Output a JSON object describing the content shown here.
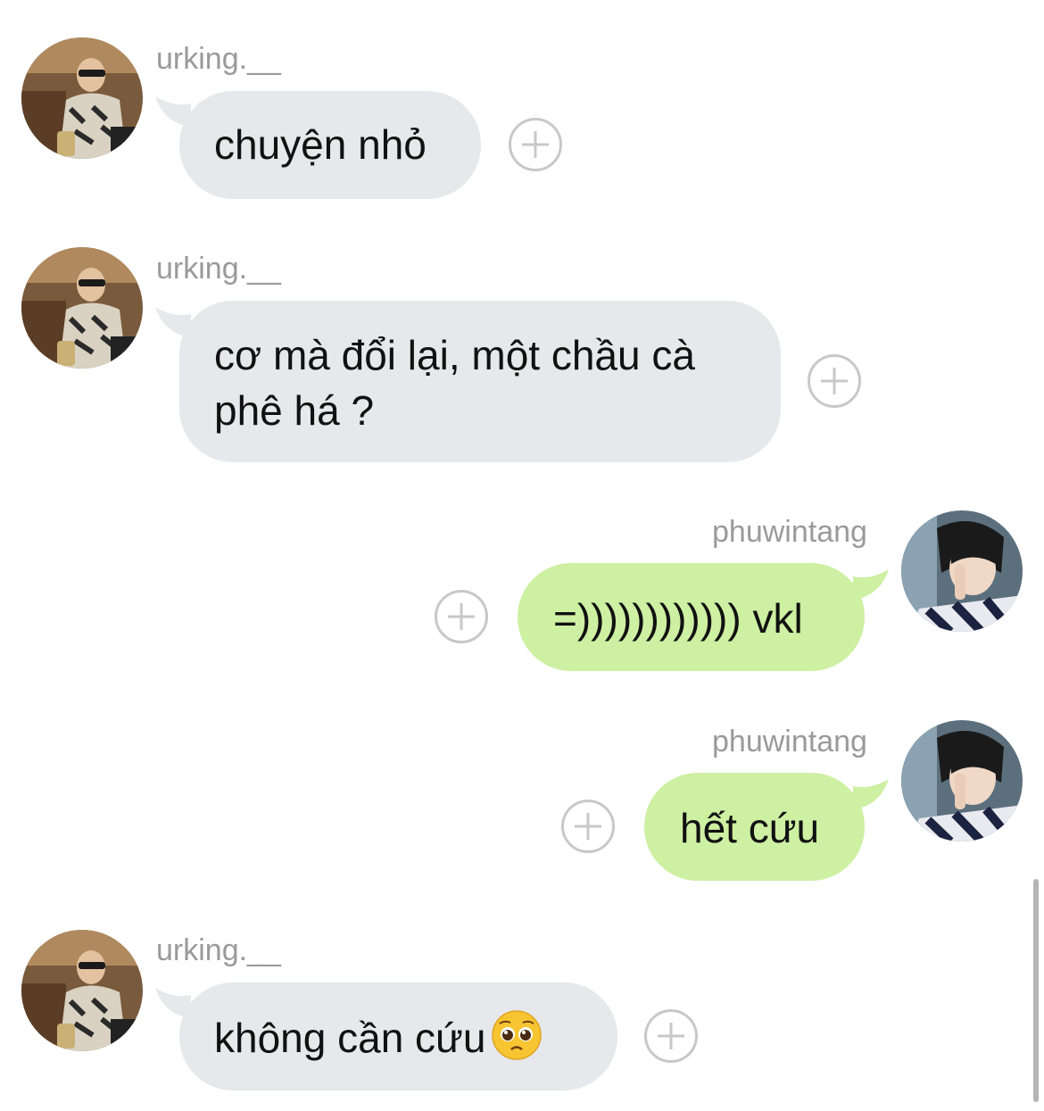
{
  "conversation": {
    "messages": [
      {
        "sender": "urking.__",
        "text": "chuyện nhỏ"
      },
      {
        "sender": "urking.__",
        "text_line1": "cơ mà đổi lại, một chầu cà",
        "text_line2": "phê há ?"
      },
      {
        "sender": "phuwintang",
        "text": "=)))))))))))) vkl"
      },
      {
        "sender": "phuwintang",
        "text": "hết cứu"
      },
      {
        "sender": "urking.__",
        "text": "không cần cứu",
        "emoji": "pleading-face-emoji"
      }
    ]
  },
  "icons": {
    "react": "add-reaction-icon",
    "avatar_left": "avatar-urking",
    "avatar_right": "avatar-phuwintang"
  },
  "colors": {
    "incoming_bubble": "#e6e8eb",
    "outgoing_bubble": "#cdf0a2",
    "username": "#9a9a9a",
    "text": "#111111"
  }
}
